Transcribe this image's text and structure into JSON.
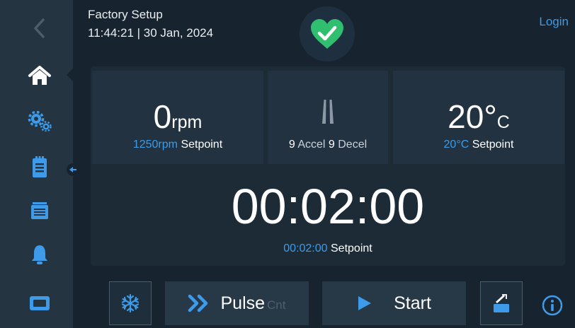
{
  "header": {
    "title": "Factory Setup",
    "datetime": "11:44:21 | 30 Jan, 2024",
    "login_label": "Login"
  },
  "sidebar": {
    "items": [
      {
        "icon": "back-arrow-icon"
      },
      {
        "icon": "home-icon",
        "active": true
      },
      {
        "icon": "settings-gears-icon"
      },
      {
        "icon": "clipboard-icon"
      },
      {
        "icon": "programs-icon"
      },
      {
        "icon": "alarm-bell-icon"
      },
      {
        "icon": "display-icon"
      }
    ]
  },
  "status": {
    "icon": "heart-check-icon",
    "state": "ok"
  },
  "speed": {
    "value": "0",
    "unit": "rpm",
    "setpoint_value": "1250rpm",
    "setpoint_label": "Setpoint"
  },
  "accel": {
    "icon": "accel-decel-icon",
    "accel_value": "9",
    "accel_label": "Accel",
    "decel_value": "9",
    "decel_label": "Decel"
  },
  "temperature": {
    "value": "20",
    "unit_degree": "°",
    "unit_letter": "C",
    "setpoint_value": "20°C",
    "setpoint_label": "Setpoint"
  },
  "timer": {
    "value": "00:02:00",
    "setpoint_value": "00:02:00",
    "setpoint_label": "Setpoint"
  },
  "controls": {
    "snowflake_icon": "snowflake-icon",
    "pulse_label": "Pulse",
    "pulse_sub": "Cnt",
    "start_label": "Start",
    "lid_icon": "lid-open-icon",
    "info_icon": "info-icon"
  },
  "colors": {
    "background": "#17232e",
    "sidebar": "#243441",
    "accent_blue": "#3d9be9",
    "status_green": "#2fbf6e"
  }
}
